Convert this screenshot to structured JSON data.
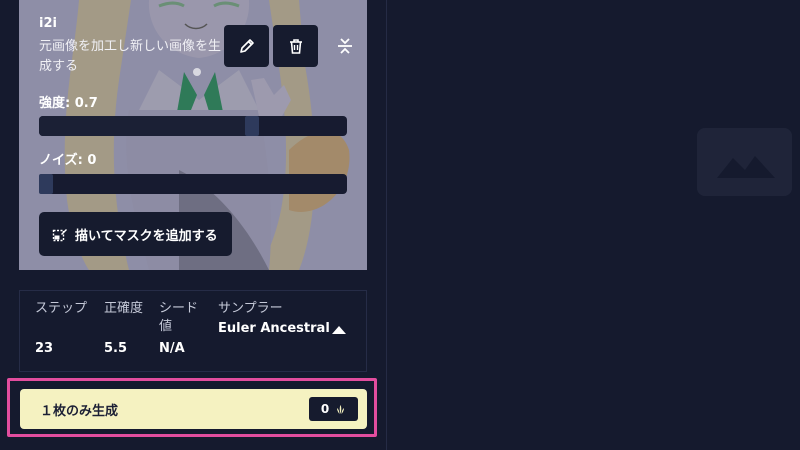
{
  "i2i": {
    "title": "i2i",
    "description": "元画像を加工し新しい画像を生成する"
  },
  "tools": [
    {
      "icon": "pencil-icon"
    },
    {
      "icon": "trash-icon"
    },
    {
      "icon": "collapse-vertical-icon"
    }
  ],
  "strength": {
    "label": "強度: 0.7",
    "value": 0.7
  },
  "noise": {
    "label": "ノイズ: 0",
    "value": 0
  },
  "mask_button": {
    "label": "描いてマスクを追加する",
    "icon": "mask-draw-icon"
  },
  "params": {
    "steps": {
      "label": "ステップ",
      "value": "23"
    },
    "scale": {
      "label": "正確度",
      "value": "5.5"
    },
    "seed": {
      "label": "シード値",
      "value": "N/A"
    },
    "sampler": {
      "label": "サンプラー",
      "value": "Euler Ancestral",
      "icon": "chevron-up-icon"
    }
  },
  "generate": {
    "label": "１枚のみ生成",
    "cost": "0",
    "cost_icon": "anlas-icon"
  },
  "preview": {
    "icon": "image-placeholder-icon"
  },
  "colors": {
    "background": "#151a2e",
    "generate_button": "#f5f2c1",
    "highlight": "#e24d9e"
  }
}
